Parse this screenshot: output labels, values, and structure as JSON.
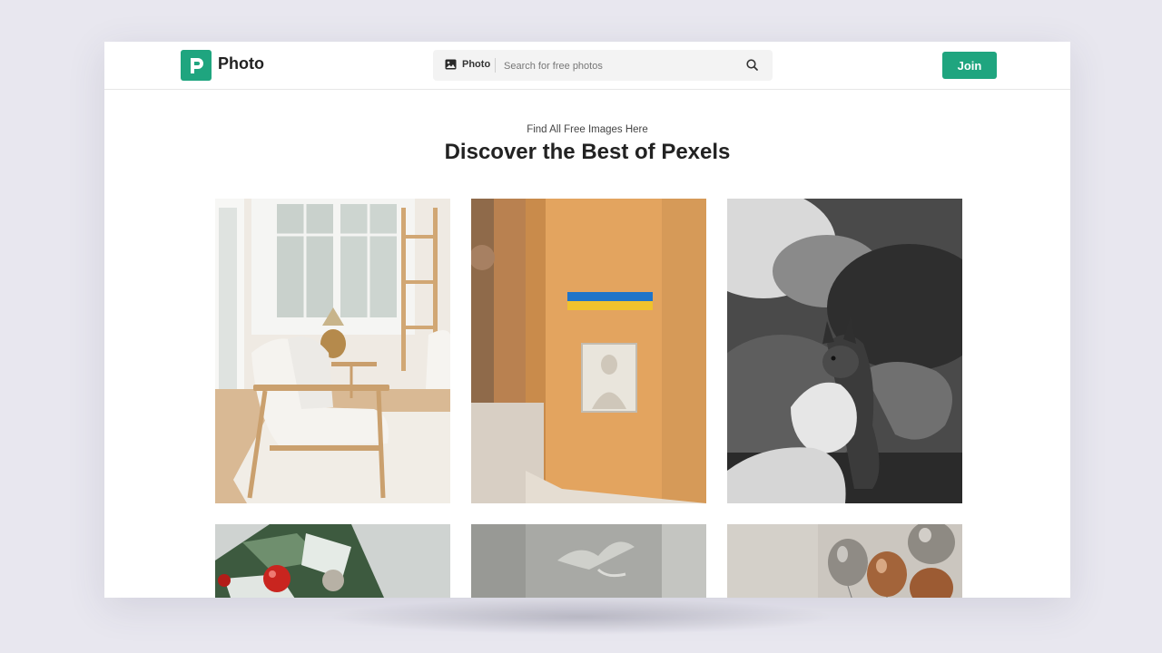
{
  "app": {
    "name": "Photo",
    "accent_color": "#1fa57f"
  },
  "navbar": {
    "logo_icon": "pexels-p-logo-icon",
    "search": {
      "type_icon": "image-icon",
      "type_label": "Photo",
      "placeholder": "Search for free photos",
      "value": "",
      "submit_icon": "search-icon"
    },
    "join_label": "Join"
  },
  "hero": {
    "subtitle": "Find All Free Images Here",
    "title": "Discover the Best of Pexels"
  },
  "gallery": {
    "photos": [
      {
        "subject": "white armchair by bright window"
      },
      {
        "subject": "orange wall with colorful sign and carved plaque"
      },
      {
        "subject": "black and white squirrel eating from hand"
      },
      {
        "subject": "christmas tree with red ornaments"
      },
      {
        "subject": "grey smoky background"
      },
      {
        "subject": "metallic balloons"
      }
    ]
  }
}
